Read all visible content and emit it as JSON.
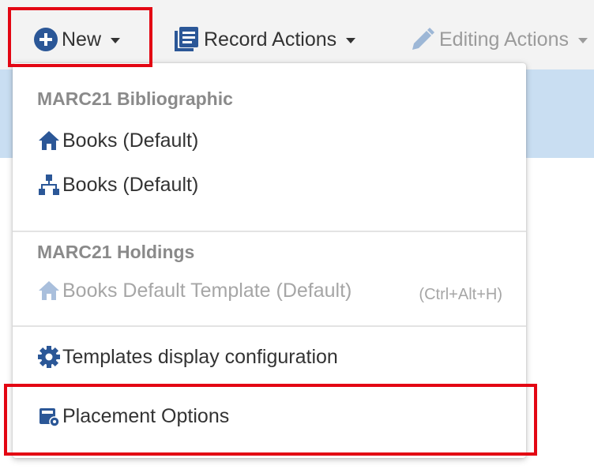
{
  "toolbar": {
    "new_label": "New",
    "record_actions_label": "Record Actions",
    "editing_actions_label": "Editing Actions"
  },
  "menu": {
    "bib_header": "MARC21 Bibliographic",
    "bib_item_1": "Books (Default)",
    "bib_item_2": "Books (Default)",
    "holdings_header": "MARC21 Holdings",
    "holdings_item": "Books Default Template (Default)",
    "holdings_shortcut": "(Ctrl+Alt+H)",
    "templates_config": "Templates display configuration",
    "placement_options": "Placement Options"
  },
  "colors": {
    "accent_blue": "#2b5797",
    "highlight_red": "#e30613",
    "band_blue": "#c9def2"
  },
  "icons": {
    "new": "plus-circle-icon",
    "record_actions": "list-icon",
    "editing_actions": "pencil-icon",
    "bib_item_1": "home-icon",
    "bib_item_2": "sitemap-icon",
    "holdings_item": "home-icon",
    "templates_config": "gear-icon",
    "placement_options": "placement-icon"
  }
}
